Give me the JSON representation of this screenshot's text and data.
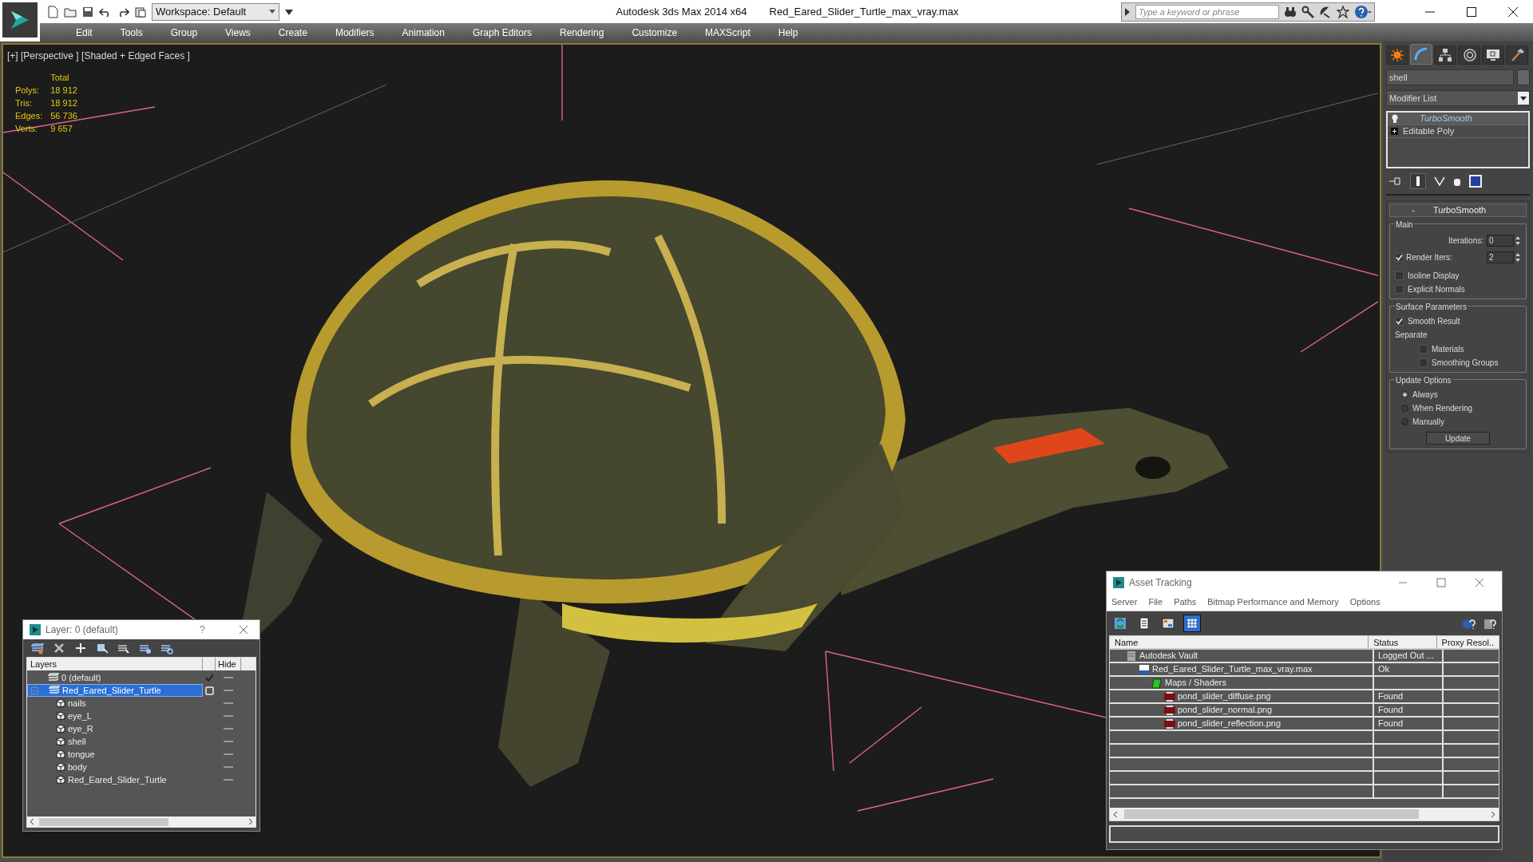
{
  "title_bar": {
    "workspace": "Workspace: Default",
    "app_title": "Autodesk 3ds Max  2014 x64",
    "file_name": "Red_Eared_Slider_Turtle_max_vray.max",
    "search": {
      "placeholder": "Type a keyword or phrase"
    }
  },
  "menu_bar": [
    "Edit",
    "Tools",
    "Group",
    "Views",
    "Create",
    "Modifiers",
    "Animation",
    "Graph Editors",
    "Rendering",
    "Customize",
    "MAXScript",
    "Help"
  ],
  "viewport": {
    "label": "[+] [Perspective ] [Shaded + Edged Faces ]",
    "stats_header": "Total",
    "stats": [
      {
        "label": "Polys:",
        "value": "18 912"
      },
      {
        "label": "Tris:",
        "value": "18 912"
      },
      {
        "label": "Edges:",
        "value": "56 736"
      },
      {
        "label": "Verts:",
        "value": "9 657"
      }
    ]
  },
  "command_panel": {
    "tabs": [
      {
        "kind": "create",
        "selected": false
      },
      {
        "kind": "modify",
        "selected": true
      },
      {
        "kind": "hierarchy",
        "selected": false
      },
      {
        "kind": "motion",
        "selected": false
      },
      {
        "kind": "display",
        "selected": false
      },
      {
        "kind": "utilities",
        "selected": false
      }
    ],
    "object_name": "shell",
    "modifier_list": "Modifier List",
    "stack": [
      {
        "label": "TurboSmooth",
        "kind": "modifier",
        "selected": true
      },
      {
        "label": "Editable Poly",
        "kind": "base",
        "selected": false
      }
    ],
    "rollout": {
      "collapse": "-",
      "title": "TurboSmooth",
      "groups": [
        {
          "title": "Main",
          "items": [
            {
              "kind": "spinner",
              "label": "Iterations:",
              "value": "0"
            },
            {
              "kind": "check-spinner",
              "label": "Render Iters:",
              "checked": true,
              "value": "2"
            },
            {
              "kind": "checkbox",
              "label": "Isoline Display",
              "checked": false
            },
            {
              "kind": "checkbox",
              "label": "Explicit Normals",
              "checked": false
            }
          ]
        },
        {
          "title": "Surface Parameters",
          "items": [
            {
              "kind": "checkbox",
              "label": "Smooth Result",
              "checked": true
            },
            {
              "kind": "caption",
              "label": "Separate"
            },
            {
              "kind": "sub-checkbox",
              "label": "Materials",
              "checked": false
            },
            {
              "kind": "sub-checkbox",
              "label": "Smoothing Groups",
              "checked": false
            }
          ]
        },
        {
          "title": "Update Options",
          "items": [
            {
              "kind": "radio",
              "label": "Always",
              "selected": true
            },
            {
              "kind": "radio",
              "label": "When Rendering",
              "selected": false
            },
            {
              "kind": "radio",
              "label": "Manually",
              "selected": false
            },
            {
              "kind": "button",
              "label": "Update"
            }
          ]
        }
      ]
    }
  },
  "layer_dialog": {
    "title": "Layer: 0 (default)",
    "help": "?",
    "columns": [
      "Layers",
      "Hide"
    ],
    "rows": [
      {
        "name": "0 (default)",
        "kind": "layer",
        "current": true,
        "selected": false
      },
      {
        "name": "Red_Eared_Slider_Turtle",
        "kind": "layer",
        "current": false,
        "selected": true,
        "expanded": true,
        "children": [
          {
            "name": "nails",
            "kind": "object",
            "selected": false
          },
          {
            "name": "eye_L",
            "kind": "object",
            "selected": false
          },
          {
            "name": "eye_R",
            "kind": "object",
            "selected": false
          },
          {
            "name": "shell",
            "kind": "object",
            "selected": false
          },
          {
            "name": "tongue",
            "kind": "object",
            "selected": false
          },
          {
            "name": "body",
            "kind": "object",
            "selected": false
          },
          {
            "name": "Red_Eared_Slider_Turtle",
            "kind": "object",
            "selected": false
          }
        ]
      }
    ]
  },
  "asset_tracking": {
    "title": "Asset Tracking",
    "menu": [
      "Server",
      "File",
      "Paths",
      "Bitmap Performance and Memory",
      "Options"
    ],
    "toolbar": [
      {
        "kind": "refresh",
        "selected": false
      },
      {
        "kind": "list",
        "selected": false
      },
      {
        "kind": "thumbnails",
        "selected": false
      },
      {
        "kind": "table",
        "selected": true
      }
    ],
    "columns": [
      "Name",
      "Status",
      "Proxy Resol.."
    ],
    "rows": [
      {
        "name": "Autodesk Vault",
        "status": "Logged Out ...",
        "kind": "vault",
        "children": [
          {
            "name": "Red_Eared_Slider_Turtle_max_vray.max",
            "status": "Ok",
            "kind": "scene",
            "children": [
              {
                "name": "Maps / Shaders",
                "kind": "folder",
                "children": [
                  {
                    "name": "pond_slider_diffuse.png",
                    "status": "Found",
                    "kind": "png"
                  },
                  {
                    "name": "pond_slider_normal.png",
                    "status": "Found",
                    "kind": "png"
                  },
                  {
                    "name": "pond_slider_reflection.png",
                    "status": "Found",
                    "kind": "png"
                  }
                ]
              }
            ]
          }
        ]
      }
    ]
  }
}
